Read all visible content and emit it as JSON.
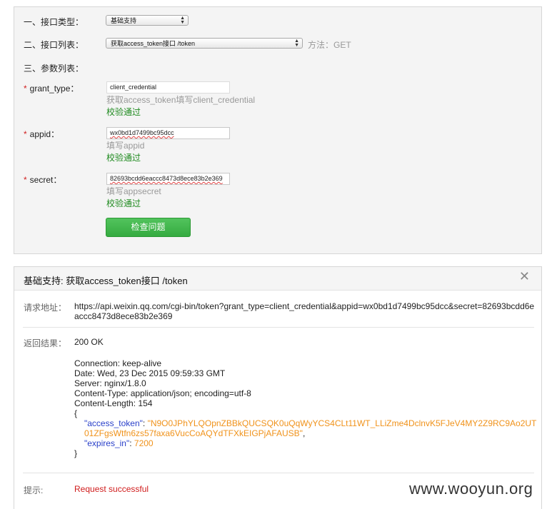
{
  "form": {
    "type_label": "一、接口类型：",
    "type_value": "基础支持",
    "list_label": "二、接口列表：",
    "list_value": "获取access_token接口 /token",
    "method_text": "方法：GET",
    "params_label": "三、参数列表：",
    "params": [
      {
        "required_mark": "*",
        "name": "grant_type：",
        "value": "client_credential",
        "hint": "获取access_token填写client_credential",
        "status": "校验通过"
      },
      {
        "required_mark": "*",
        "name": "appid：",
        "value": "wx0bd1d7499bc95dcc",
        "hint": "填写appid",
        "status": "校验通过"
      },
      {
        "required_mark": "*",
        "name": "secret：",
        "value": "82693bcdd6eaccc8473d8ece83b2e369",
        "hint": "填写appsecret",
        "status": "校验通过"
      }
    ],
    "check_button": "检查问题"
  },
  "result": {
    "title": "基础支持: 获取access_token接口 /token",
    "close_icon": "✕",
    "request_label": "请求地址：",
    "request_url": "https://api.weixin.qq.com/cgi-bin/token?grant_type=client_credential&appid=wx0bd1d7499bc95dcc&secret=82693bcdd6eaccc8473d8ece83b2e369",
    "response_label": "返回结果：",
    "status_line": "200 OK",
    "headers": [
      "Connection: keep-alive",
      "Date: Wed, 23 Dec 2015 09:59:33 GMT",
      "Server: nginx/1.8.0",
      "Content-Type: application/json; encoding=utf-8",
      "Content-Length: 154"
    ],
    "json_open": "{",
    "json_close": "}",
    "access_token_key": "\"access_token\"",
    "access_token_value": "\"N9O0JPhYLQOpnZBBkQUCSQK0uQqWyYCS4CLt11WT_LLiZme4DclnvK5FJeV4MY2Z9RC9Ao2UT01ZFgsWtfn6zs57faxa6VucCoAQYdTFXkEIGPjAFAUSB\"",
    "expires_key": "\"expires_in\"",
    "expires_value": "7200",
    "colon": ": ",
    "comma": ",",
    "tip_label": "提示:",
    "tip_value": "Request successful"
  },
  "watermark": "www.wooyun.org",
  "colors": {
    "success": "#1e8a1e",
    "required": "#d02020",
    "button": "#3db248",
    "json_key": "#2a40c9",
    "json_value": "#f0921a",
    "error_tip": "#d01c1c"
  }
}
